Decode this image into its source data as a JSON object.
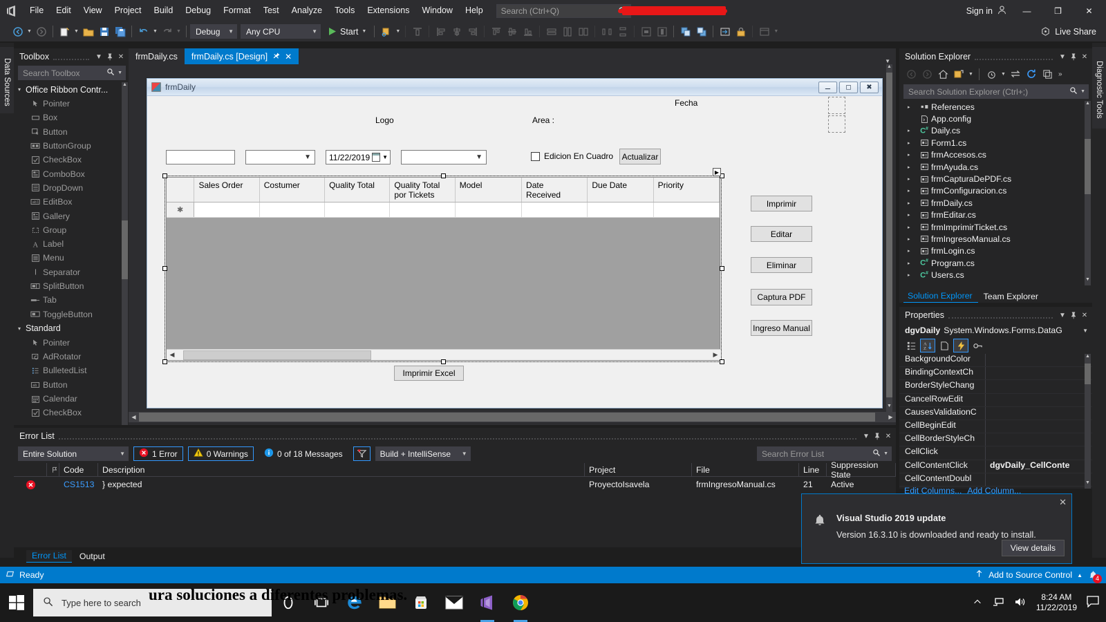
{
  "titlebar": {
    "menu": [
      "File",
      "Edit",
      "View",
      "Project",
      "Build",
      "Debug",
      "Format",
      "Test",
      "Analyze",
      "Tools",
      "Extensions",
      "Window",
      "Help"
    ],
    "search_placeholder": "Search (Ctrl+Q)",
    "signin": "Sign in",
    "minimize": "—",
    "maximize": "❐",
    "close": "✕"
  },
  "toolbar": {
    "config": "Debug",
    "platform": "Any CPU",
    "start": "Start",
    "live_share": "Live Share"
  },
  "rails": {
    "left_vertical_tab": "Data Sources",
    "right_vertical_tab": "Diagnostic Tools"
  },
  "toolbox": {
    "title": "Toolbox",
    "search_placeholder": "Search Toolbox",
    "groups": [
      {
        "name": "Office Ribbon Contr...",
        "items": [
          {
            "label": "Pointer",
            "icon": "pointer-icon"
          },
          {
            "label": "Box",
            "icon": "box-icon"
          },
          {
            "label": "Button",
            "icon": "button-icon"
          },
          {
            "label": "ButtonGroup",
            "icon": "buttongroup-icon"
          },
          {
            "label": "CheckBox",
            "icon": "checkbox-icon"
          },
          {
            "label": "ComboBox",
            "icon": "combobox-icon"
          },
          {
            "label": "DropDown",
            "icon": "dropdown-icon"
          },
          {
            "label": "EditBox",
            "icon": "editbox-icon"
          },
          {
            "label": "Gallery",
            "icon": "gallery-icon"
          },
          {
            "label": "Group",
            "icon": "group-icon"
          },
          {
            "label": "Label",
            "icon": "label-icon"
          },
          {
            "label": "Menu",
            "icon": "menu-icon"
          },
          {
            "label": "Separator",
            "icon": "separator-icon"
          },
          {
            "label": "SplitButton",
            "icon": "splitbutton-icon"
          },
          {
            "label": "Tab",
            "icon": "tab-icon"
          },
          {
            "label": "ToggleButton",
            "icon": "togglebutton-icon"
          }
        ]
      },
      {
        "name": "Standard",
        "items": [
          {
            "label": "Pointer",
            "icon": "pointer-icon"
          },
          {
            "label": "AdRotator",
            "icon": "adrotator-icon"
          },
          {
            "label": "BulletedList",
            "icon": "bulletedlist-icon"
          },
          {
            "label": "Button",
            "icon": "button-icon"
          },
          {
            "label": "Calendar",
            "icon": "calendar-icon"
          },
          {
            "label": "CheckBox",
            "icon": "checkbox-icon"
          }
        ]
      }
    ]
  },
  "doctabs": [
    {
      "label": "frmDaily.cs",
      "active": false
    },
    {
      "label": "frmDaily.cs [Design]",
      "active": true
    }
  ],
  "form": {
    "title": "frmDaily",
    "labels": {
      "logo": "Logo",
      "fecha": "Fecha",
      "area": "Area :"
    },
    "date_value": "11/22/2019",
    "checkbox_label": "Edicion En Cuadro",
    "actualizar": "Actualizar",
    "grid_columns": [
      "Sales Order",
      "Costumer",
      "Quality Total",
      "Quality Total\npor Tickets",
      "Model",
      "Date\nReceived",
      "Due Date",
      "Priority"
    ],
    "grid_columns_line1": [
      "Sales Order",
      "Costumer",
      "Quality Total",
      "Quality Total",
      "Model",
      "Date",
      "Due Date",
      "Priority"
    ],
    "grid_columns_line2": [
      "",
      "",
      "",
      "por Tickets",
      "",
      "Received",
      "",
      ""
    ],
    "side_buttons": [
      "Imprimir",
      "Editar",
      "Eliminar",
      "Captura PDF",
      "Ingreso Manual"
    ],
    "bottom_button": "Imprimir Excel"
  },
  "solution_explorer": {
    "title": "Solution Explorer",
    "search_placeholder": "Search Solution Explorer (Ctrl+;)",
    "nodes": [
      {
        "label": "References",
        "icon": "references-icon",
        "expandable": true
      },
      {
        "label": "App.config",
        "icon": "config-icon",
        "expandable": false
      },
      {
        "label": "Daily.cs",
        "icon": "csharp-icon",
        "expandable": true
      },
      {
        "label": "Form1.cs",
        "icon": "form-icon",
        "expandable": true
      },
      {
        "label": "frmAccesos.cs",
        "icon": "form-icon",
        "expandable": true
      },
      {
        "label": "frmAyuda.cs",
        "icon": "form-icon",
        "expandable": true
      },
      {
        "label": "frmCapturaDePDF.cs",
        "icon": "form-icon",
        "expandable": true
      },
      {
        "label": "frmConfiguracion.cs",
        "icon": "form-icon",
        "expandable": true
      },
      {
        "label": "frmDaily.cs",
        "icon": "form-icon",
        "expandable": true
      },
      {
        "label": "frmEditar.cs",
        "icon": "form-icon",
        "expandable": true
      },
      {
        "label": "frmImprimirTicket.cs",
        "icon": "form-icon",
        "expandable": true
      },
      {
        "label": "frmIngresoManual.cs",
        "icon": "form-icon",
        "expandable": true
      },
      {
        "label": "frmLogin.cs",
        "icon": "form-icon",
        "expandable": true
      },
      {
        "label": "Program.cs",
        "icon": "csharp-icon",
        "expandable": true
      },
      {
        "label": "Users.cs",
        "icon": "csharp-icon",
        "expandable": true
      }
    ],
    "tabs": [
      {
        "label": "Solution Explorer",
        "selected": true
      },
      {
        "label": "Team Explorer",
        "selected": false
      }
    ]
  },
  "properties": {
    "title": "Properties",
    "object_name": "dgvDaily",
    "object_type": "System.Windows.Forms.DataG",
    "rows": [
      {
        "name": "BackgroundColor",
        "value": ""
      },
      {
        "name": "BindingContextCh",
        "value": ""
      },
      {
        "name": "BorderStyleChang",
        "value": ""
      },
      {
        "name": "CancelRowEdit",
        "value": ""
      },
      {
        "name": "CausesValidationC",
        "value": ""
      },
      {
        "name": "CellBeginEdit",
        "value": ""
      },
      {
        "name": "CellBorderStyleCh",
        "value": ""
      },
      {
        "name": "CellClick",
        "value": ""
      },
      {
        "name": "CellContentClick",
        "value": "dgvDaily_CellConte"
      },
      {
        "name": "CellContentDoubl",
        "value": ""
      }
    ],
    "links": [
      "Edit Columns...",
      "Add Column..."
    ]
  },
  "error_list": {
    "title": "Error List",
    "scope": "Entire Solution",
    "errors_label": "1 Error",
    "warnings_label": "0 Warnings",
    "messages_label": "0 of 18 Messages",
    "build_filter": "Build + IntelliSense",
    "search_placeholder": "Search Error List",
    "columns": [
      "",
      "",
      "Code",
      "Description",
      "Project",
      "File",
      "Line",
      "Suppression State"
    ],
    "rows": [
      {
        "code": "CS1513",
        "description": "} expected",
        "project": "ProyectoIsavela",
        "file": "frmIngresoManual.cs",
        "line": "21",
        "suppression": "Active"
      }
    ],
    "bottom_tabs": [
      {
        "label": "Error List",
        "selected": true
      },
      {
        "label": "Output",
        "selected": false
      }
    ]
  },
  "toast": {
    "title": "Visual Studio 2019 update",
    "text": "Version 16.3.10 is downloaded and ready to install.",
    "button": "View details",
    "close": "✕"
  },
  "statusbar": {
    "status": "Ready",
    "source_control": "Add to Source Control",
    "notification_count": "4"
  },
  "taskbar": {
    "search_placeholder": "Type here to search",
    "clock_time": "8:24 AM",
    "clock_date": "11/22/2019"
  },
  "overlay": {
    "text": "ura soluciones a diferentes problemas."
  },
  "colors": {
    "accent": "#007acc",
    "panel_bg": "#252526",
    "chrome_bg": "#2d2d30",
    "editor_bg": "#1e1e1e",
    "error_red": "#e81123",
    "link_blue": "#3b9dff"
  }
}
